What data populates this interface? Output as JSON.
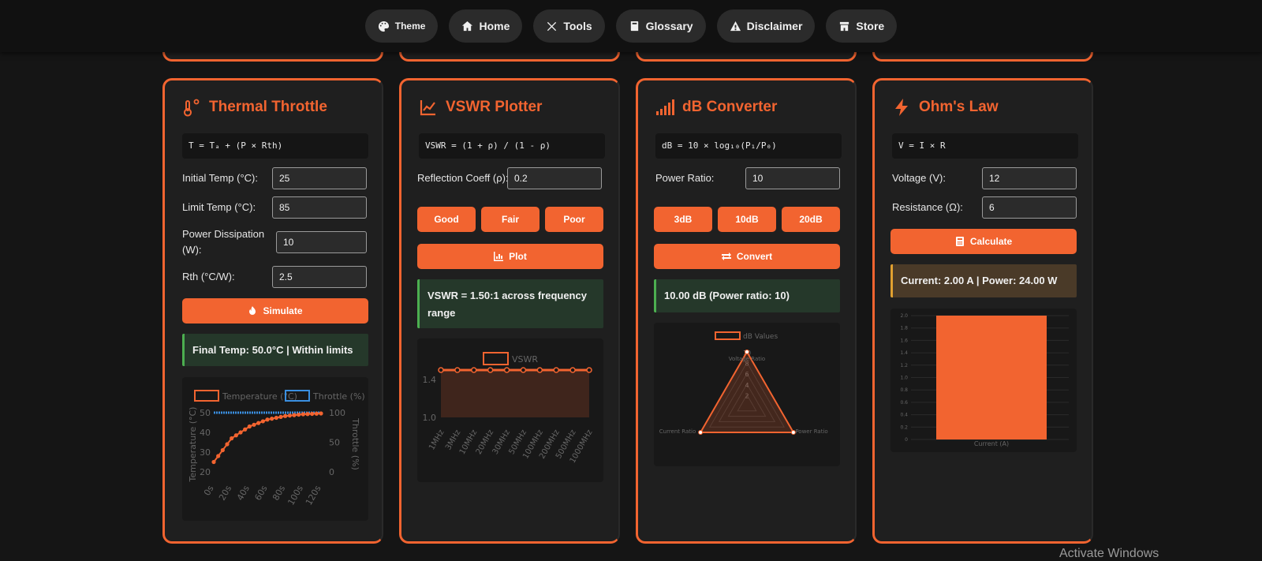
{
  "nav": {
    "theme": "Theme",
    "home": "Home",
    "tools": "Tools",
    "glossary": "Glossary",
    "disclaimer": "Disclaimer",
    "store": "Store"
  },
  "colors": {
    "accent": "#f26430",
    "success": "#4caf50",
    "warning": "#e0a030",
    "throttle": "#3a8fe0"
  },
  "thermal": {
    "title": "Thermal Throttle",
    "formula": "T = Tₐ + (P × Rth)",
    "labels": {
      "initial": "Initial Temp (°C):",
      "limit": "Limit Temp (°C):",
      "power_1": "Power Dissipation",
      "power_2": "(W):",
      "rth": "Rth (°C/W):"
    },
    "values": {
      "initial": "25",
      "limit": "85",
      "power": "10",
      "rth": "2.5"
    },
    "button": "Simulate",
    "result": "Final Temp: 50.0°C | Within limits"
  },
  "vswr": {
    "title": "VSWR Plotter",
    "formula": "VSWR = (1 + ρ) / (1 - ρ)",
    "label": "Reflection Coeff (ρ):",
    "value": "0.2",
    "presets": [
      "Good",
      "Fair",
      "Poor"
    ],
    "button": "Plot",
    "result": "VSWR = 1.50:1 across frequency range"
  },
  "db": {
    "title": "dB Converter",
    "formula": "dB = 10 × log₁₀(P₁/P₀)",
    "label": "Power Ratio:",
    "value": "10",
    "presets": [
      "3dB",
      "10dB",
      "20dB"
    ],
    "button": "Convert",
    "result": "10.00 dB (Power ratio: 10)"
  },
  "ohm": {
    "title": "Ohm's Law",
    "formula": "V = I × R",
    "labels": {
      "voltage": "Voltage (V):",
      "resistance": "Resistance (Ω):"
    },
    "values": {
      "voltage": "12",
      "resistance": "6"
    },
    "button": "Calculate",
    "result": "Current: 2.00 A | Power: 24.00 W"
  },
  "chart_data": [
    {
      "type": "line",
      "legend": [
        "Temperature (°C)",
        "Throttle (%)"
      ],
      "x": [
        "0s",
        "20s",
        "40s",
        "60s",
        "80s",
        "100s",
        "120s"
      ],
      "ylabel": "Temperature (°C)",
      "y2label": "Throttle (%)",
      "ylim": [
        20,
        50
      ],
      "y2lim": [
        0,
        100
      ],
      "yticks": [
        "20",
        "30",
        "40",
        "50"
      ],
      "y2ticks": [
        "0",
        "50",
        "100"
      ],
      "series": [
        {
          "name": "Temperature (°C)",
          "values": [
            25,
            37,
            43,
            46.5,
            48.3,
            49.2,
            49.6
          ]
        },
        {
          "name": "Throttle (%)",
          "values": [
            100,
            100,
            100,
            100,
            100,
            100,
            100
          ]
        }
      ]
    },
    {
      "type": "line",
      "legend": [
        "VSWR"
      ],
      "categories": [
        "1MHz",
        "3MHz",
        "10MHz",
        "20MHz",
        "30MHz",
        "50MHz",
        "100MHz",
        "200MHz",
        "500MHz",
        "1000MHz"
      ],
      "yticks": [
        "1.0",
        "1.4"
      ],
      "ylim": [
        1.0,
        1.5
      ],
      "series": [
        {
          "name": "VSWR",
          "values": [
            1.5,
            1.5,
            1.5,
            1.5,
            1.5,
            1.5,
            1.5,
            1.5,
            1.5,
            1.5
          ]
        }
      ]
    },
    {
      "type": "radar",
      "legend": [
        "dB Values"
      ],
      "axes": [
        "Voltage Ratio",
        "Power Ratio",
        "Current Ratio"
      ],
      "rticks": [
        "2",
        "4",
        "6",
        "8",
        "10"
      ],
      "series": [
        {
          "name": "dB Values",
          "values": [
            10,
            10,
            10
          ]
        }
      ]
    },
    {
      "type": "bar",
      "categories": [
        "Current (A)"
      ],
      "values": [
        2.0
      ],
      "ylim": [
        0,
        2.0
      ],
      "yticks": [
        "0",
        "0.2",
        "0.4",
        "0.6",
        "0.8",
        "1.0",
        "1.2",
        "1.4",
        "1.6",
        "1.8",
        "2.0"
      ]
    }
  ]
}
